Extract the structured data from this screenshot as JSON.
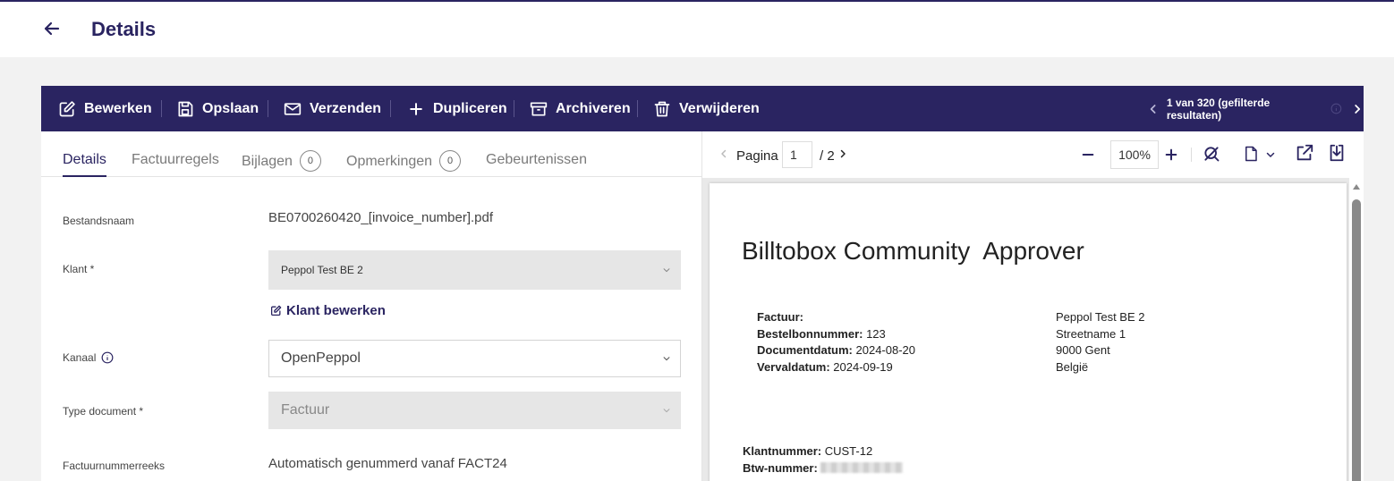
{
  "header": {
    "title": "Details"
  },
  "toolbar": {
    "edit_label": "Bewerken",
    "save_label": "Opslaan",
    "send_label": "Verzenden",
    "duplicate_label": "Dupliceren",
    "archive_label": "Archiveren",
    "delete_label": "Verwijderen",
    "pagination_text": "1 van 320 (gefilterde resultaten)"
  },
  "tabs": {
    "details": "Details",
    "lines": "Factuurregels",
    "attachments": "Bijlagen",
    "attachments_count": "0",
    "remarks": "Opmerkingen",
    "remarks_count": "0",
    "events": "Gebeurtenissen"
  },
  "form": {
    "filename_label": "Bestandsnaam",
    "filename_value": "BE0700260420_[invoice_number].pdf",
    "customer_label": "Klant *",
    "customer_value": "Peppol Test BE 2",
    "edit_customer_label": "Klant bewerken",
    "channel_label": "Kanaal",
    "channel_value": "OpenPeppol",
    "doctype_label": "Type document *",
    "doctype_value": "Factuur",
    "series_label": "Factuurnummerreeks",
    "series_value": "Automatisch genummerd vanaf FACT24"
  },
  "viewer": {
    "page_label": "Pagina",
    "page_value": "1",
    "page_total": "/ 2",
    "zoom_value": "100%"
  },
  "document": {
    "title": "Billtobox Community  Approver",
    "invoice_label": "Factuur:",
    "po_label": "Bestelbonnummer:",
    "po_value": " 123",
    "docdate_label": "Documentdatum:",
    "docdate_value": " 2024-08-20",
    "duedate_label": "Vervaldatum:",
    "duedate_value": " 2024-09-19",
    "address_name": "Peppol Test BE 2",
    "address_street": "Streetname 1",
    "address_city": "9000 Gent",
    "address_country": "België",
    "customer_no_label": "Klantnummer:",
    "customer_no_value": " CUST-12",
    "vat_label": "Btw-nummer:"
  },
  "colors": {
    "primary": "#2a2461",
    "background": "#f2f2f2",
    "disabled_field": "#e6e6e6"
  },
  "icons": [
    "arrow-left-icon",
    "pencil-square-icon",
    "floppy-disk-icon",
    "envelope-icon",
    "plus-icon",
    "archive-box-icon",
    "trash-icon",
    "chevron-left-icon",
    "chevron-right-icon",
    "info-icon",
    "chevron-down-icon",
    "minus-icon",
    "no-zoom-icon",
    "file-icon",
    "external-link-icon",
    "download-icon"
  ]
}
